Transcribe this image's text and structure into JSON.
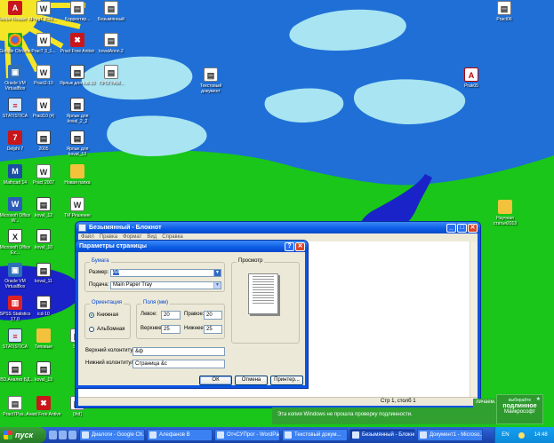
{
  "desktop": {
    "icons": [
      {
        "label": "Adobe Reader XI",
        "glyph": "A",
        "style": "g-red",
        "col": 0,
        "row": 0
      },
      {
        "label": "ProgТ 80ld...",
        "glyph": "W",
        "style": "g-doc",
        "col": 1,
        "row": 0
      },
      {
        "label": "Koppектир...",
        "glyph": "▤",
        "style": "g-doc",
        "col": 2,
        "row": 0
      },
      {
        "label": "Безымянный",
        "glyph": "▤",
        "style": "g-doc",
        "col": 3,
        "row": 0
      },
      {
        "label": "Google Chrome",
        "glyph": "",
        "style": "g-chrome",
        "col": 0,
        "row": 1
      },
      {
        "label": "PracТ 3_1...",
        "glyph": "W",
        "style": "g-doc",
        "col": 1,
        "row": 1
      },
      {
        "label": "Pract Free Antivir",
        "glyph": "✖",
        "style": "g-red",
        "col": 2,
        "row": 1
      },
      {
        "label": "kovalАnnn.2",
        "glyph": "▤",
        "style": "g-doc",
        "col": 3,
        "row": 1
      },
      {
        "label": "Oracle VM VirtualBox",
        "glyph": "▣",
        "style": "g-vbox",
        "col": 0,
        "row": 2
      },
      {
        "label": "Pract2-10",
        "glyph": "W",
        "style": "g-doc",
        "col": 1,
        "row": 2
      },
      {
        "label": "Ярлык для icd-10",
        "glyph": "▤",
        "style": "g-grid",
        "col": 2,
        "row": 2
      },
      {
        "label": "ПРОГРАМ...",
        "glyph": "▤",
        "style": "g-doc",
        "col": 3,
        "row": 2
      },
      {
        "label": "STATISTICA",
        "glyph": "≡",
        "style": "g-chart",
        "col": 0,
        "row": 3
      },
      {
        "label": "Pract10 (4)",
        "glyph": "W",
        "style": "g-doc",
        "col": 1,
        "row": 3
      },
      {
        "label": "Ярлык для koval_2_2",
        "glyph": "▤",
        "style": "g-grid",
        "col": 2,
        "row": 3
      },
      {
        "label": "Delphi 7",
        "glyph": "7",
        "style": "g-red",
        "col": 0,
        "row": 4
      },
      {
        "label": "2005",
        "glyph": "▤",
        "style": "g-grid",
        "col": 1,
        "row": 4
      },
      {
        "label": "Ярлык для koval_13",
        "glyph": "▤",
        "style": "g-grid",
        "col": 2,
        "row": 4
      },
      {
        "label": "Mathcad 14",
        "glyph": "M",
        "style": "g-stat",
        "col": 0,
        "row": 5
      },
      {
        "label": "Pract 2007",
        "glyph": "W",
        "style": "g-doc",
        "col": 1,
        "row": 5
      },
      {
        "label": "Новая папка",
        "glyph": "",
        "style": "g-folder",
        "col": 2,
        "row": 5
      },
      {
        "label": "Microsoft Office W...",
        "glyph": "W",
        "style": "g-word",
        "col": 0,
        "row": 6
      },
      {
        "label": "koval_12",
        "glyph": "▤",
        "style": "g-grid",
        "col": 1,
        "row": 6
      },
      {
        "label": "ТМ Решение",
        "glyph": "W",
        "style": "g-doc",
        "col": 2,
        "row": 6
      },
      {
        "label": "Microsoft Office Ex...",
        "glyph": "X",
        "style": "g-grid",
        "col": 0,
        "row": 7
      },
      {
        "label": "koval_10",
        "glyph": "▤",
        "style": "g-grid",
        "col": 1,
        "row": 7
      },
      {
        "label": "Oracle VM VirtualBox",
        "glyph": "▣",
        "style": "g-vbox",
        "col": 0,
        "row": 8
      },
      {
        "label": "koval_11",
        "glyph": "▤",
        "style": "g-grid",
        "col": 1,
        "row": 8
      },
      {
        "label": "SPSS Statistics 17.0",
        "glyph": "▥",
        "style": "g-spss",
        "col": 0,
        "row": 9
      },
      {
        "label": "icd-10",
        "glyph": "▤",
        "style": "g-grid",
        "col": 1,
        "row": 9
      },
      {
        "label": "STATISTICA",
        "glyph": "≡",
        "style": "g-chart",
        "col": 0,
        "row": 10
      },
      {
        "label": "Типовые",
        "glyph": "",
        "style": "g-folder",
        "col": 1,
        "row": 10
      },
      {
        "label": "SAS",
        "glyph": "▤",
        "style": "g-doc",
        "col": 2,
        "row": 10
      },
      {
        "label": "OBD.Анализ БД...",
        "glyph": "▤",
        "style": "g-grid",
        "col": 0,
        "row": 11
      },
      {
        "label": "koval_13",
        "glyph": "▤",
        "style": "g-grid",
        "col": 1,
        "row": 11
      },
      {
        "label": "Pract7Pas...",
        "glyph": "▤",
        "style": "g-doc",
        "col": 0,
        "row": 12
      },
      {
        "label": "Avast Free Antivir",
        "glyph": "✖",
        "style": "g-red",
        "col": 1,
        "row": 12
      },
      {
        "label": "[ihd]",
        "glyph": "▤",
        "style": "g-doc",
        "col": 2,
        "row": 12
      }
    ],
    "extra_icons": [
      {
        "label": "Pract06",
        "glyph": "▤",
        "style": "g-doc",
        "pos": "top-right"
      },
      {
        "label": "Текстовый документ",
        "glyph": "▤",
        "style": "g-doc",
        "pos": "center"
      },
      {
        "label": "Prak05",
        "glyph": "A",
        "style": "g-pdf",
        "pos": "right"
      },
      {
        "label": "Научная статья2013",
        "glyph": "",
        "style": "g-folder",
        "pos": "right-lower"
      }
    ]
  },
  "notepad": {
    "title": "Безымянный - Блокнот",
    "menu": [
      "Файл",
      "Правка",
      "Формат",
      "Вид",
      "Справка"
    ],
    "status_pos": "Стр 1, столб 1"
  },
  "dialog": {
    "title": "Параметры страницы",
    "help_glyph": "?",
    "close_glyph": "✕",
    "paper_group": "Бумага",
    "size_label": "Размер:",
    "size_value": "A4",
    "source_label": "Подача:",
    "source_value": "Main Paper Tray",
    "orientation_group": "Ориентация",
    "portrait_label": "Книжная",
    "landscape_label": "Альбомная",
    "orientation_selected": "portrait",
    "margins_group": "Поля (мм)",
    "left_label": "Левое:",
    "left_value": "20",
    "right_label": "Правое:",
    "right_value": "20",
    "top_label": "Верхнее:",
    "top_value": "25",
    "bottom_label": "Нижнее:",
    "bottom_value": "25",
    "header_label": "Верхний колонтитул:",
    "header_value": "&ф",
    "footer_label": "Нижний колонтитул:",
    "footer_value": "Страница &c",
    "preview_group": "Просмотр",
    "ok_label": "ОК",
    "cancel_label": "Отмена",
    "printer_label": "Принтер..."
  },
  "notification": {
    "message": "Эта копия Windows не прошла проверку подлинности.",
    "tail": "личаем.",
    "badge_top": "выбирайте",
    "badge_mid": "подлинное",
    "badge_bot": "Майкрософт"
  },
  "taskbar": {
    "start_label": "пуск",
    "tasks": [
      {
        "label": "Диалоги - Google Ch...",
        "active": false
      },
      {
        "label": "Алефанов В",
        "active": false
      },
      {
        "label": "ОтчСУПрог - WordPad",
        "active": false
      },
      {
        "label": "Текстовый докум...",
        "active": false
      },
      {
        "label": "Безымянный - Блокнот",
        "active": true
      },
      {
        "label": "Документ1 - Microso...",
        "active": false
      }
    ],
    "language": "EN",
    "clock": "14:48"
  }
}
